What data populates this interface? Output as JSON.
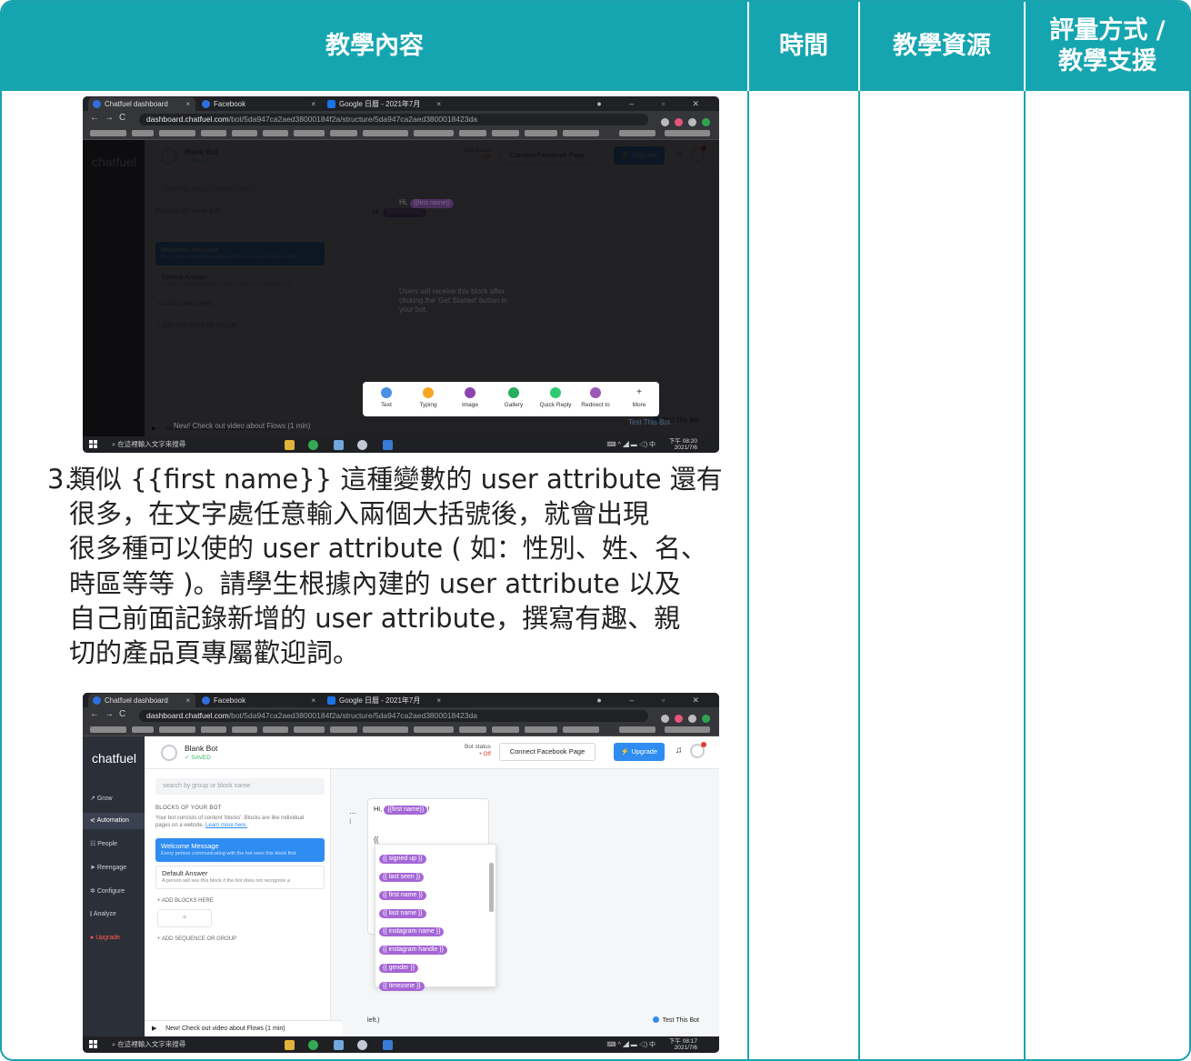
{
  "table": {
    "headers": [
      "教學內容",
      "時間",
      "教學資源",
      "評量方式 /",
      "教學支援"
    ]
  },
  "browser": {
    "tabs": [
      "Chatfuel dashboard",
      "Facebook",
      "Google 日曆 - 2021年7月"
    ],
    "url_host": "dashboard.chatfuel.com",
    "url_path": "/bot/5da947ca2aed38000184f2a/structure/5da947ca2aed3800018423da",
    "taskbar_search": "在這裡輸入文字來搜尋",
    "time1": "下午 08:20",
    "time2": "下午 08:17",
    "date": "2021/7/6"
  },
  "chatfuel": {
    "logo": "chatfuel",
    "bot_name": "Blank Bot",
    "saved": "✓ SAVED",
    "bot_status_label": "Bot status",
    "bot_status_value": "• Off",
    "connect_button": "Connect Facebook Page",
    "upgrade_button": "⚡ Upgrade",
    "sidebar": [
      "Grow",
      "Automation",
      "People",
      "Reengage",
      "Configure",
      "Analyze",
      "Upgrade"
    ],
    "search_placeholder": "search by group or block name",
    "blocks_heading": "BLOCKS OF YOUR BOT",
    "blocks_desc": "Your bot consists of content 'blocks'. Blocks are like individual pages on a website.",
    "learn_more": "Learn more here.",
    "welcome_title": "Welcome Message",
    "welcome_sub": "Every person communicating with the bot sees this block first",
    "default_title": "Default Answer",
    "default_sub": "A person will see this block if the bot does not recognize a",
    "add_blocks": "+ ADD BLOCKS HERE",
    "add_seq": "+ ADD SEQUENCE OR GROUP",
    "video_note": "New! Check out video about Flows (1 min)",
    "test_bot": "Test This Bot",
    "hi": "Hi,",
    "first_name_chip": "{{first name}}",
    "welcome_hint": "Users will receive this block after clicking the 'Get Started' button in your bot.",
    "typed": "{{",
    "left_text": "left.)",
    "attr_options": [
      "{{ signed up }}",
      "{{ last seen }}",
      "{{ first name }}",
      "{{ last name }}",
      "{{ instagram name }}",
      "{{ instagram handle }}",
      "{{ gender }}",
      "{{ timezone }}"
    ],
    "toolbar_items": [
      "Text",
      "Typing",
      "Image",
      "Gallery",
      "Quick Reply",
      "Redirect to",
      "More"
    ]
  },
  "body": {
    "number": "3.",
    "lines": [
      "類似 {{first name}} 這種變數的 user attribute 還有",
      "很多，在文字處任意輸入兩個大括號後，就會出現",
      "很多種可以使的 user attribute ( 如：性別、姓、名、",
      "時區等等 )。請學生根據內建的 user attribute 以及",
      "自己前面記錄新增的 user attribute，撰寫有趣、親",
      "切的產品頁專屬歡迎詞。"
    ]
  },
  "colors": {
    "header_bg": "#15a5b0",
    "border": "#1aa3ad",
    "chip": "#a566d6",
    "primary": "#2f8cf0"
  }
}
